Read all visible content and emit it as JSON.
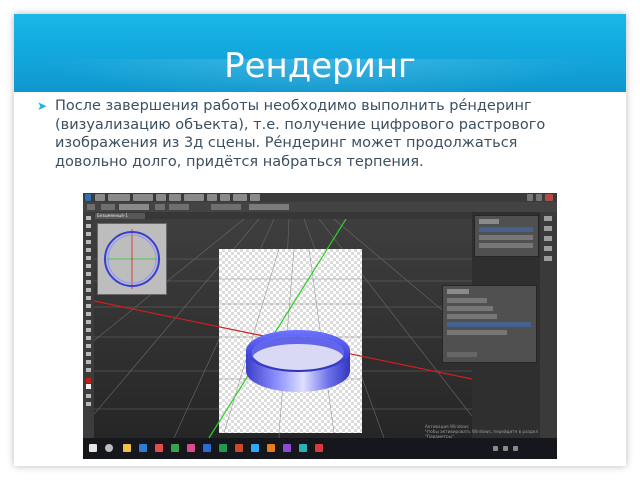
{
  "slide": {
    "title": "Рендеринг",
    "paragraph": "После завершения работы необходимо выполнить ре́ндеринг (визуализацию объекта), т.е. получение цифрового растрового изображения из 3д сцены. Ре́ндеринг может продолжаться довольно долго, придётся набраться терпения.",
    "bullet_icon": "bullet-arrow-icon",
    "colors": {
      "header": "#12a6dc",
      "text": "#3c5061",
      "bullet": "#19b3e6"
    }
  },
  "screenshot": {
    "app": "Photoshop 3D rendering",
    "tab_label": "Безымянный-1",
    "watermark_line1": "Активация Windows",
    "watermark_line2": "Чтобы активировать Windows, перейдите в раздел \"Параметры\".",
    "clock_time": "",
    "clock_date": "",
    "colors": {
      "ring_dark": "#3a3fd0",
      "ring_light": "#8f93ff",
      "grid_line": "#6e6e6e",
      "axis_red": "#d21e1e",
      "axis_green": "#2ad12a",
      "axis_blue": "#2a56ff"
    }
  }
}
